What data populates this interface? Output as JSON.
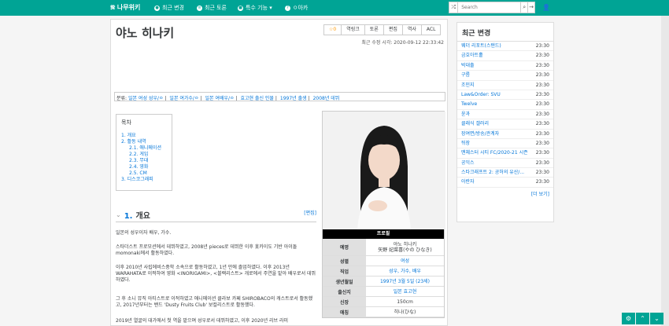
{
  "topbar": {
    "logo": "𝕹 나무위키",
    "nav": [
      {
        "icon": "compass-icon",
        "label": "최근 변경"
      },
      {
        "icon": "list-icon",
        "label": "최근 토론"
      },
      {
        "icon": "cube-icon",
        "label": "특수 기능 ▾"
      },
      {
        "icon": "help-icon",
        "label": "ㅇ아카"
      }
    ],
    "search_placeholder": "Search"
  },
  "article": {
    "title": "야노 히나키",
    "actions": [
      "☆0",
      "역링크",
      "토론",
      "편집",
      "역사",
      "ACL"
    ],
    "last_modified": "최근 수정 시각: 2020-09-12 22:33:42",
    "category_label": "분류:",
    "categories": [
      "일본 여성 성우/ㅇ",
      "일본 여가수/ㅇ",
      "일본 여배우/ㅇ",
      "효고현 출신 인물",
      "1997년 출생",
      "2008년 데뷔"
    ],
    "toc": {
      "title": "목차",
      "items": [
        {
          "num": "1.",
          "label": "개요",
          "sub": false
        },
        {
          "num": "2.",
          "label": "활동 내역",
          "sub": false
        },
        {
          "num": "2.1.",
          "label": "애니메이션",
          "sub": true
        },
        {
          "num": "2.2.",
          "label": "게임",
          "sub": true
        },
        {
          "num": "2.3.",
          "label": "무대",
          "sub": true
        },
        {
          "num": "2.4.",
          "label": "영화",
          "sub": true
        },
        {
          "num": "2.5.",
          "label": "CM",
          "sub": true
        },
        {
          "num": "3.",
          "label": "디스코그래피",
          "sub": false
        }
      ]
    },
    "section": {
      "num": "1.",
      "title": "개요",
      "edit": "[편집]"
    },
    "paragraphs": [
      "일본의 성우이자 배우, 가수.",
      "스타더스트 프로모션에서 데뷔하였고, 2008년 pieces로 데뷔한 이후 홋카이도 기반 아이돌 momonaki에서 활동하였다.",
      "이후 2010년 사립에비스중학 소속으로 활동하였고, 1년 만에 졸업하였다. 이후 2013년 WARAHATA로 이적하여 영화 <INORIGAMI>, <블랙리스트> 개로에서 주연을 맡아 배우로서 데뷔하였다.",
      "그 후 소니 뮤직 아티스트로 이적하였고 애니메이션 클라보 카페 SHIROBACO의 캐스트로서 활동했고, 2017년부터는 밴드 'Dusty Fruits Club' 보컬리스트로 활동했다.",
      "2019년 열굴의 대가에서 첫 역을 맡으며 성우로서 데뷔하였고, 이후 2020년 리브 라미"
    ],
    "infobox": {
      "header": "프로필",
      "rows": [
        {
          "key": "예명",
          "value": "야노 히나키",
          "value2": "矢野 妃菜喜(やの ひなき)"
        },
        {
          "key": "성별",
          "value": "여성"
        },
        {
          "key": "직업",
          "value": "성우, 가수, 배우"
        },
        {
          "key": "생년월일",
          "value": "1997년 3월 5일 (23세)"
        },
        {
          "key": "출신지",
          "value": "일본 효고현"
        },
        {
          "key": "신장",
          "value": "150cm"
        },
        {
          "key": "애칭",
          "value": "히나(ひな)"
        }
      ]
    }
  },
  "sidebar": {
    "title": "최근 변경",
    "items": [
      {
        "name": "웨더 리포트(스탠드)",
        "time": "23:30"
      },
      {
        "name": "금호아트홀",
        "time": "23:30"
      },
      {
        "name": "박대출",
        "time": "23:30"
      },
      {
        "name": "구름",
        "time": "23:30"
      },
      {
        "name": "조민지",
        "time": "23:30"
      },
      {
        "name": "Law&Order: SVU",
        "time": "23:30"
      },
      {
        "name": "Twelve",
        "time": "23:30"
      },
      {
        "name": "윤과",
        "time": "23:30"
      },
      {
        "name": "클래식 갤러리",
        "time": "23:30"
      },
      {
        "name": "장여면/방송/관계자",
        "time": "23:30"
      },
      {
        "name": "뒤장",
        "time": "23:30"
      },
      {
        "name": "맨체스터 시티 FC/2020-21 시즌",
        "time": "23:30"
      },
      {
        "name": "공익스",
        "time": "23:30"
      },
      {
        "name": "스타크래프트 2: 공허의 유산/...",
        "time": "23:30"
      },
      {
        "name": "아란자",
        "time": "23:30"
      }
    ],
    "more": "[더 보기]"
  },
  "colors": {
    "brand": "#00a495",
    "link": "#0275d8"
  }
}
